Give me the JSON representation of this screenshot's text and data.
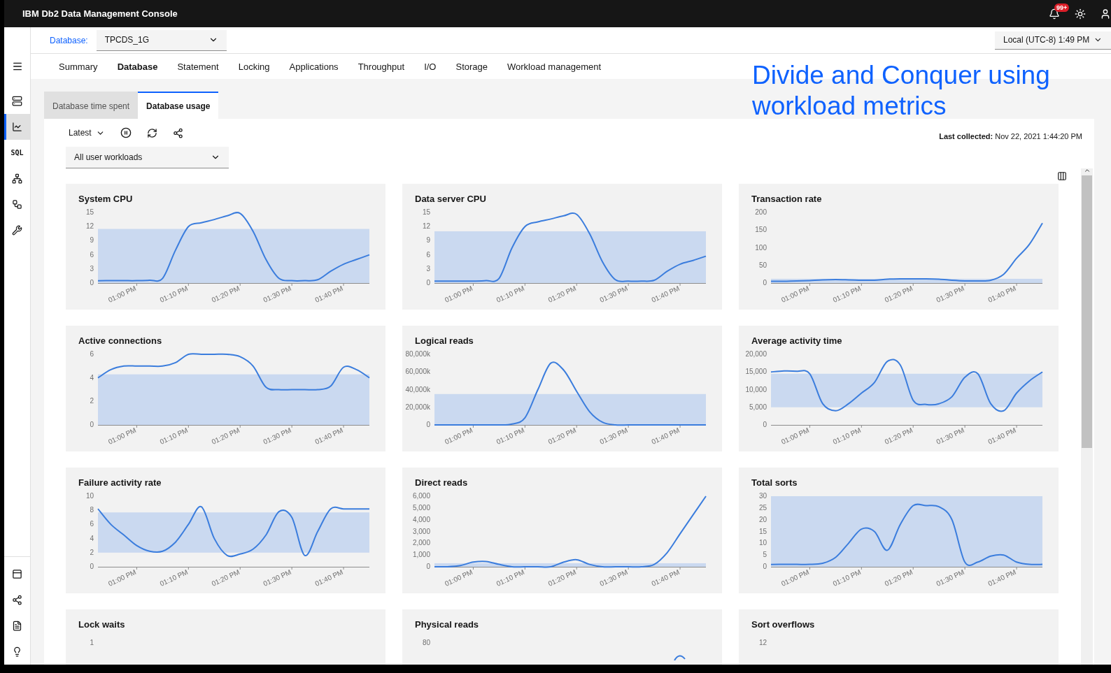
{
  "app": {
    "title": "IBM Db2 Data Management Console",
    "notifications": "99+"
  },
  "database": {
    "label": "Database:",
    "value": "TPCDS_1G"
  },
  "timezone": "Local (UTC-8) 1:49 PM",
  "sidebar": {
    "top": [
      {
        "selected": false
      },
      {
        "selected": true
      },
      {
        "label": "SQL",
        "selected": false
      },
      {
        "selected": false
      },
      {
        "selected": false
      },
      {
        "selected": false
      }
    ],
    "bottom": [
      {
        "selected": false
      },
      {
        "selected": false
      },
      {
        "selected": false
      },
      {
        "selected": false
      }
    ]
  },
  "nav_tabs": [
    {
      "label": "Summary",
      "selected": false
    },
    {
      "label": "Database",
      "selected": true
    },
    {
      "label": "Statement",
      "selected": false
    },
    {
      "label": "Locking",
      "selected": false
    },
    {
      "label": "Applications",
      "selected": false
    },
    {
      "label": "Throughput",
      "selected": false
    },
    {
      "label": "I/O",
      "selected": false
    },
    {
      "label": "Storage",
      "selected": false
    },
    {
      "label": "Workload management",
      "selected": false
    }
  ],
  "sub_tabs": [
    {
      "label": "Database time spent",
      "selected": false
    },
    {
      "label": "Database usage",
      "selected": true
    }
  ],
  "annotation": "Divide and Conquer using workload metrics",
  "toolbar": {
    "range": "Latest",
    "workload": "All user workloads",
    "last_collected": "**Last collected:** Nov 22, 2021 1:44:20 PM"
  },
  "charts": [
    {
      "title": "System CPU",
      "chart_data": {
        "type": "line",
        "categories": [
          null,
          null,
          null,
          "01:00 PM",
          null,
          null,
          null,
          "01:10 PM",
          null,
          null,
          null,
          "01:20 PM",
          null,
          null,
          null,
          "01:30 PM",
          null,
          null,
          null,
          "01:40 PM",
          null,
          null
        ],
        "ylim": [
          0,
          15
        ],
        "yticks": [
          0,
          3,
          6,
          9,
          12,
          15
        ],
        "bands": [
          {
            "axis": "y",
            "from": 0,
            "to": 11.5
          }
        ],
        "values": [
          0.5,
          0.5,
          0.5,
          0.5,
          0.6,
          1,
          7,
          12,
          12.8,
          13.5,
          14.3,
          14.8,
          11,
          5,
          1,
          0.5,
          0.5,
          0.7,
          2.5,
          4,
          5,
          6
        ]
      }
    },
    {
      "title": "Data server CPU",
      "chart_data": {
        "type": "line",
        "categories": [
          null,
          null,
          null,
          "01:00 PM",
          null,
          null,
          null,
          "01:10 PM",
          null,
          null,
          null,
          "01:20 PM",
          null,
          null,
          null,
          "01:30 PM",
          null,
          null,
          null,
          "01:40 PM",
          null,
          null
        ],
        "ylim": [
          0,
          15
        ],
        "yticks": [
          0,
          3,
          6,
          9,
          12,
          15
        ],
        "bands": [
          {
            "axis": "y",
            "from": 0,
            "to": 11
          }
        ],
        "values": [
          0.4,
          0.4,
          0.4,
          0.4,
          0.5,
          1,
          7.5,
          12,
          13,
          13.6,
          14.3,
          14.6,
          10.5,
          4.5,
          0.7,
          0.4,
          0.4,
          0.6,
          2.5,
          4,
          4.8,
          5.7
        ]
      }
    },
    {
      "title": "Transaction rate",
      "chart_data": {
        "type": "line",
        "categories": [
          null,
          null,
          null,
          "01:00 PM",
          null,
          null,
          null,
          "01:10 PM",
          null,
          null,
          null,
          "01:20 PM",
          null,
          null,
          null,
          "01:30 PM",
          null,
          null,
          null,
          "01:40 PM",
          null,
          null
        ],
        "ylim": [
          0,
          200
        ],
        "yticks": [
          0,
          50,
          100,
          150,
          200
        ],
        "bands": [
          {
            "axis": "y",
            "from": 0,
            "to": 12
          }
        ],
        "values": [
          5,
          5,
          6,
          7,
          9,
          10,
          9,
          8,
          8,
          11,
          12,
          12,
          12,
          11,
          8,
          6,
          6,
          8,
          25,
          70,
          110,
          170
        ]
      }
    },
    {
      "title": "Active connections",
      "chart_data": {
        "type": "line",
        "categories": [
          null,
          null,
          null,
          "01:00 PM",
          null,
          null,
          null,
          "01:10 PM",
          null,
          null,
          null,
          "01:20 PM",
          null,
          null,
          null,
          "01:30 PM",
          null,
          null,
          null,
          "01:40 PM",
          null,
          null
        ],
        "ylim": [
          0,
          6
        ],
        "yticks": [
          0,
          2,
          4,
          6
        ],
        "bands": [
          {
            "axis": "y",
            "from": 0,
            "to": 4.3
          }
        ],
        "values": [
          4,
          4.7,
          5,
          5,
          5,
          5,
          5.3,
          6,
          6,
          6,
          6,
          5.8,
          5,
          3.2,
          3,
          3,
          3,
          3,
          3.3,
          4.9,
          4.7,
          4
        ]
      }
    },
    {
      "title": "Logical reads",
      "chart_data": {
        "type": "line",
        "categories": [
          null,
          null,
          null,
          "01:00 PM",
          null,
          null,
          null,
          "01:10 PM",
          null,
          null,
          null,
          "01:20 PM",
          null,
          null,
          null,
          "01:30 PM",
          null,
          null,
          null,
          "01:40 PM",
          null,
          null
        ],
        "ylim": [
          0,
          80000
        ],
        "yticks": [
          0,
          {
            "value": 20000,
            "label": "20,000k"
          },
          {
            "value": 40000,
            "label": "40,000k"
          },
          {
            "value": 60000,
            "label": "60,000k"
          },
          {
            "value": 80000,
            "label": "80,000k"
          }
        ],
        "bands": [
          {
            "axis": "y",
            "from": 0,
            "to": 35000
          }
        ],
        "values": [
          0,
          0,
          0,
          0,
          0,
          0,
          1000,
          8000,
          40000,
          70000,
          62000,
          38000,
          15000,
          3000,
          0,
          0,
          0,
          0,
          0,
          0,
          0,
          0
        ]
      }
    },
    {
      "title": "Average activity time",
      "chart_data": {
        "type": "line",
        "categories": [
          null,
          null,
          null,
          "01:00 PM",
          null,
          null,
          null,
          "01:10 PM",
          null,
          null,
          null,
          "01:20 PM",
          null,
          null,
          null,
          "01:30 PM",
          null,
          null,
          null,
          "01:40 PM",
          null,
          null
        ],
        "ylim": [
          0,
          20000
        ],
        "yticks": [
          0,
          {
            "value": 5000,
            "label": "5,000"
          },
          {
            "value": 10000,
            "label": "10,000"
          },
          {
            "value": 15000,
            "label": "15,000"
          },
          {
            "value": 20000,
            "label": "20,000"
          }
        ],
        "bands": [
          {
            "axis": "y",
            "from": 5000,
            "to": 14500
          }
        ],
        "values": [
          15000,
          15300,
          15200,
          14500,
          6000,
          4000,
          6000,
          9000,
          12000,
          18000,
          17000,
          7000,
          5800,
          6000,
          8000,
          13500,
          14500,
          6000,
          4000,
          9000,
          12500,
          15000
        ]
      }
    },
    {
      "title": "Failure activity rate",
      "chart_data": {
        "type": "line",
        "categories": [
          null,
          null,
          null,
          "01:00 PM",
          null,
          null,
          null,
          "01:10 PM",
          null,
          null,
          null,
          "01:20 PM",
          null,
          null,
          null,
          "01:30 PM",
          null,
          null,
          null,
          "01:40 PM",
          null,
          null
        ],
        "ylim": [
          0,
          10
        ],
        "yticks": [
          0,
          2,
          4,
          6,
          8,
          10
        ],
        "bands": [
          {
            "axis": "y",
            "from": 2,
            "to": 7.7
          }
        ],
        "values": [
          8.2,
          6,
          4.5,
          3,
          2.2,
          2.2,
          3.5,
          6,
          8.5,
          4,
          1.6,
          1.8,
          2.5,
          4.5,
          7.8,
          7,
          1.6,
          5,
          8.2,
          8.2,
          8.2,
          8.2
        ]
      }
    },
    {
      "title": "Direct reads",
      "chart_data": {
        "type": "line",
        "categories": [
          null,
          null,
          null,
          "01:00 PM",
          null,
          null,
          null,
          "01:10 PM",
          null,
          null,
          null,
          "01:20 PM",
          null,
          null,
          null,
          "01:30 PM",
          null,
          null,
          null,
          "01:40 PM",
          null,
          null
        ],
        "ylim": [
          0,
          6000
        ],
        "yticks": [
          0,
          {
            "value": 1000,
            "label": "1,000"
          },
          {
            "value": 2000,
            "label": "2,000"
          },
          {
            "value": 3000,
            "label": "3,000"
          },
          {
            "value": 4000,
            "label": "4,000"
          },
          {
            "value": 5000,
            "label": "5,000"
          },
          {
            "value": 6000,
            "label": "6,000"
          }
        ],
        "bands": [
          {
            "axis": "y",
            "from": 0,
            "to": 300
          }
        ],
        "values": [
          0,
          0,
          100,
          400,
          450,
          200,
          0,
          0,
          0,
          0,
          400,
          600,
          200,
          0,
          0,
          0,
          0,
          200,
          1200,
          2800,
          4400,
          6000
        ]
      }
    },
    {
      "title": "Total sorts",
      "chart_data": {
        "type": "line",
        "categories": [
          null,
          null,
          null,
          "01:00 PM",
          null,
          null,
          null,
          "01:10 PM",
          null,
          null,
          null,
          "01:20 PM",
          null,
          null,
          null,
          "01:30 PM",
          null,
          null,
          null,
          "01:40 PM",
          null,
          null
        ],
        "ylim": [
          0,
          30
        ],
        "yticks": [
          0,
          5,
          10,
          15,
          20,
          25,
          30
        ],
        "bands": [
          {
            "axis": "y",
            "from": 0,
            "to": 30
          }
        ],
        "values": [
          1,
          1,
          1,
          1,
          1.5,
          4,
          10,
          16,
          15,
          7,
          18,
          26,
          26,
          25.5,
          20,
          2,
          2,
          4.5,
          5,
          2,
          1,
          1
        ]
      }
    }
  ],
  "partial_charts": [
    {
      "title": "Lock waits",
      "top_tick": "1",
      "line_visible": false
    },
    {
      "title": "Physical reads",
      "top_tick": "80",
      "line_visible": true
    },
    {
      "title": "Sort overflows",
      "top_tick": "12",
      "line_visible": false
    }
  ]
}
